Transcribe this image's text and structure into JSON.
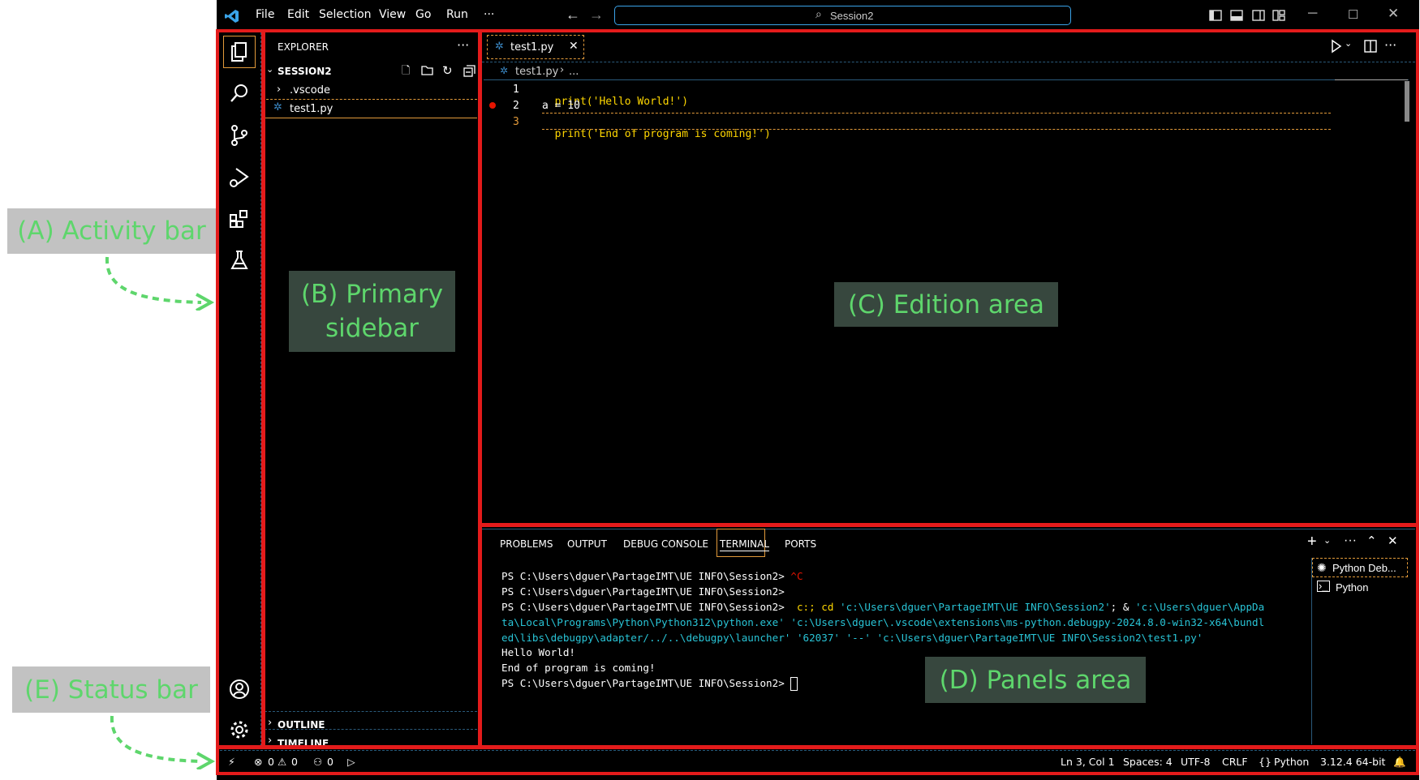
{
  "menu": [
    "File",
    "Edit",
    "Selection",
    "View",
    "Go",
    "Run",
    "···"
  ],
  "search_text": "Session2",
  "explorer": {
    "title": "EXPLORER",
    "folder": "SESSION2",
    "items": [
      ".vscode",
      "test1.py"
    ],
    "outline": "OUTLINE",
    "timeline": "TIMELINE"
  },
  "editor": {
    "tab": "test1.py",
    "breadcrumb_file": "test1.py",
    "breadcrumb_more": "...",
    "line_numbers": [
      "1",
      "2",
      "3"
    ],
    "code": {
      "line1_fn": "print",
      "line1_args": "('Hello World!')",
      "line2": "a = 10",
      "line3_fn": "print",
      "line3_args": "('End of program is coming!')"
    }
  },
  "panel": {
    "tabs": [
      "PROBLEMS",
      "OUTPUT",
      "DEBUG CONSOLE",
      "TERMINAL",
      "PORTS"
    ],
    "active_tab": "TERMINAL",
    "terminal": {
      "l1_prompt": "PS C:\\Users\\dguer\\PartageIMT\\UE INFO\\Session2> ",
      "l1_ctrl": "^C",
      "l2": "PS C:\\Users\\dguer\\PartageIMT\\UE INFO\\Session2>",
      "l3_prompt": "PS C:\\Users\\dguer\\PartageIMT\\UE INFO\\Session2>  ",
      "l3_cmd": "c:; cd",
      "l3_arg1": " 'c:\\Users\\dguer\\PartageIMT\\UE INFO\\Session2'",
      "l3_amp": "; & ",
      "l3_arg2": "'c:\\Users\\dguer\\AppDa",
      "l4": "ta\\Local\\Programs\\Python\\Python312\\python.exe' 'c:\\Users\\dguer\\.vscode\\extensions\\ms-python.debugpy-2024.8.0-win32-x64\\bundl",
      "l5": "ed\\libs\\debugpy\\adapter/../..\\debugpy\\launcher' '62037' '--' 'c:\\Users\\dguer\\PartageIMT\\UE INFO\\Session2\\test1.py'",
      "l6": "Hello World!",
      "l7": "End of program is coming!",
      "l8": "PS C:\\Users\\dguer\\PartageIMT\\UE INFO\\Session2> "
    },
    "sessions": [
      "Python Deb...",
      "Python"
    ]
  },
  "status": {
    "errors": "0",
    "warnings": "0",
    "ports": "0",
    "position": "Ln 3, Col 1",
    "spaces": "Spaces: 4",
    "encoding": "UTF-8",
    "eol": "CRLF",
    "language": "Python",
    "interpreter": "3.12.4 64-bit"
  },
  "annotations": {
    "activity_bar": "(A) Activity bar",
    "primary_sidebar_1": "(B) Primary",
    "primary_sidebar_2": "sidebar",
    "edition_area": "(C) Edition area",
    "panels_area": "(D) Panels area",
    "status_bar": "(E) Status bar"
  },
  "colors": {
    "highlight_red": "#e31b1b",
    "annotation_green": "#5ed66c",
    "accent_orange": "#e29a3a"
  }
}
